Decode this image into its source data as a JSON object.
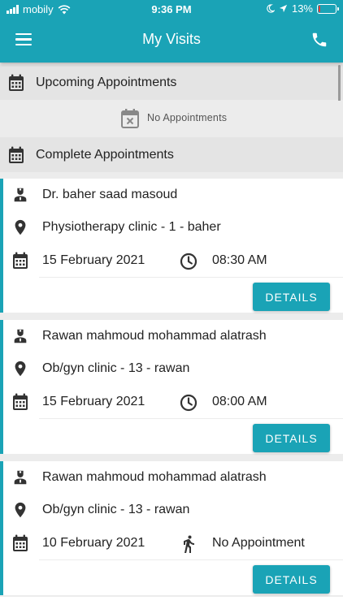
{
  "status_bar": {
    "carrier": "mobily",
    "time": "9:36 PM",
    "battery_percent": "13%",
    "battery_level": 0.13
  },
  "app_bar": {
    "title": "My Visits",
    "menu_icon": "hamburger-icon",
    "call_icon": "phone-icon"
  },
  "upcoming": {
    "title": "Upcoming Appointments",
    "empty_text": "No Appointments"
  },
  "complete": {
    "title": "Complete Appointments"
  },
  "appointments": [
    {
      "doctor": "Dr. baher saad masoud",
      "clinic": "Physiotherapy clinic - 1 - baher",
      "date": "15 February 2021",
      "time": "08:30 AM",
      "time_icon": "clock-icon",
      "button": "DETAILS"
    },
    {
      "doctor": "Rawan mahmoud mohammad alatrash",
      "clinic": "Ob/gyn clinic - 13 - rawan",
      "date": "15 February 2021",
      "time": "08:00 AM",
      "time_icon": "clock-icon",
      "button": "DETAILS"
    },
    {
      "doctor": "Rawan mahmoud mohammad alatrash",
      "clinic": "Ob/gyn clinic - 13 - rawan",
      "date": "10 February 2021",
      "time": "No Appointment",
      "time_icon": "walking-person-icon",
      "button": "DETAILS"
    }
  ],
  "colors": {
    "primary": "#1aa3b6",
    "header_bg": "#e4e4e4",
    "battery_low": "#e53935"
  }
}
